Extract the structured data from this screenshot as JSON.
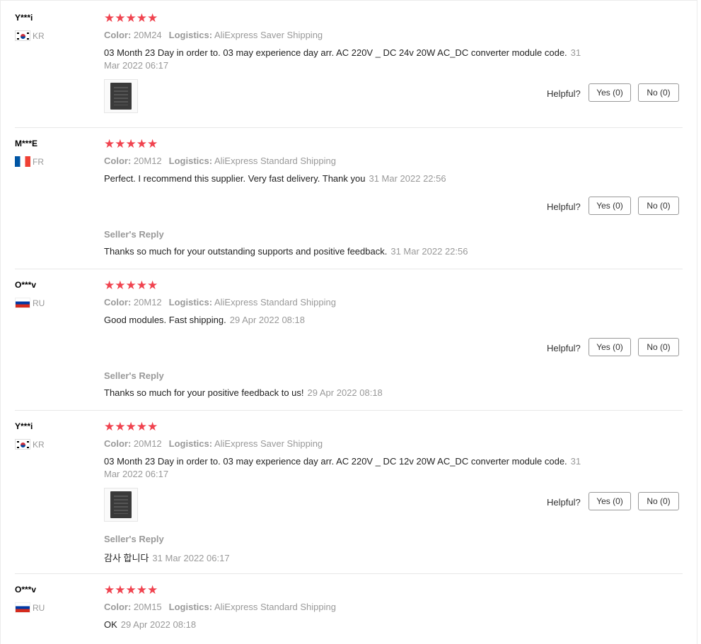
{
  "helpful_label": "Helpful?",
  "labels": {
    "color": "Color:",
    "logistics": "Logistics:",
    "seller_reply": "Seller's Reply"
  },
  "reviews": [
    {
      "user": "Y***i",
      "country": "KR",
      "flag": "kr-flag-icon",
      "rating": 5,
      "color": "20M24",
      "logistics": "AliExpress Saver Shipping",
      "text": "03 Month 23 Day in order to. 03 may experience day arr. AC 220V _ DC 24v 20W AC_DC converter module code.",
      "date": "31 Mar 2022 06:17",
      "yes": "Yes (0)",
      "no": "No (0)"
    },
    {
      "user": "M***E",
      "country": "FR",
      "flag": "fr-flag-icon",
      "rating": 5,
      "color": "20M12",
      "logistics": "AliExpress Standard Shipping",
      "text": "Perfect. I recommend this supplier. Very fast delivery. Thank you",
      "date": "31 Mar 2022 22:56",
      "yes": "Yes (0)",
      "no": "No (0)",
      "reply_text": "Thanks so much for your outstanding supports and positive feedback.",
      "reply_date": "31 Mar 2022 22:56"
    },
    {
      "user": "O***v",
      "country": "RU",
      "flag": "ru-flag-icon",
      "rating": 5,
      "color": "20M12",
      "logistics": "AliExpress Standard Shipping",
      "text": "Good modules. Fast shipping.",
      "date": "29 Apr 2022 08:18",
      "yes": "Yes (0)",
      "no": "No (0)",
      "reply_text": "Thanks so much for your positive feedback to us!",
      "reply_date": "29 Apr 2022 08:18"
    },
    {
      "user": "Y***i",
      "country": "KR",
      "flag": "kr-flag-icon",
      "rating": 5,
      "color": "20M12",
      "logistics": "AliExpress Saver Shipping",
      "text": "03 Month 23 Day in order to. 03 may experience day arr. AC 220V _ DC 12v 20W AC_DC converter module code.",
      "date": "31 Mar 2022 06:17",
      "yes": "Yes (0)",
      "no": "No (0)",
      "reply_text": "감사 합니다",
      "reply_date": "31 Mar 2022 06:17"
    },
    {
      "user": "O***v",
      "country": "RU",
      "flag": "ru-flag-icon",
      "rating": 5,
      "color": "20M15",
      "logistics": "AliExpress Standard Shipping",
      "text": "OK",
      "date": "29 Apr 2022 08:18"
    }
  ]
}
